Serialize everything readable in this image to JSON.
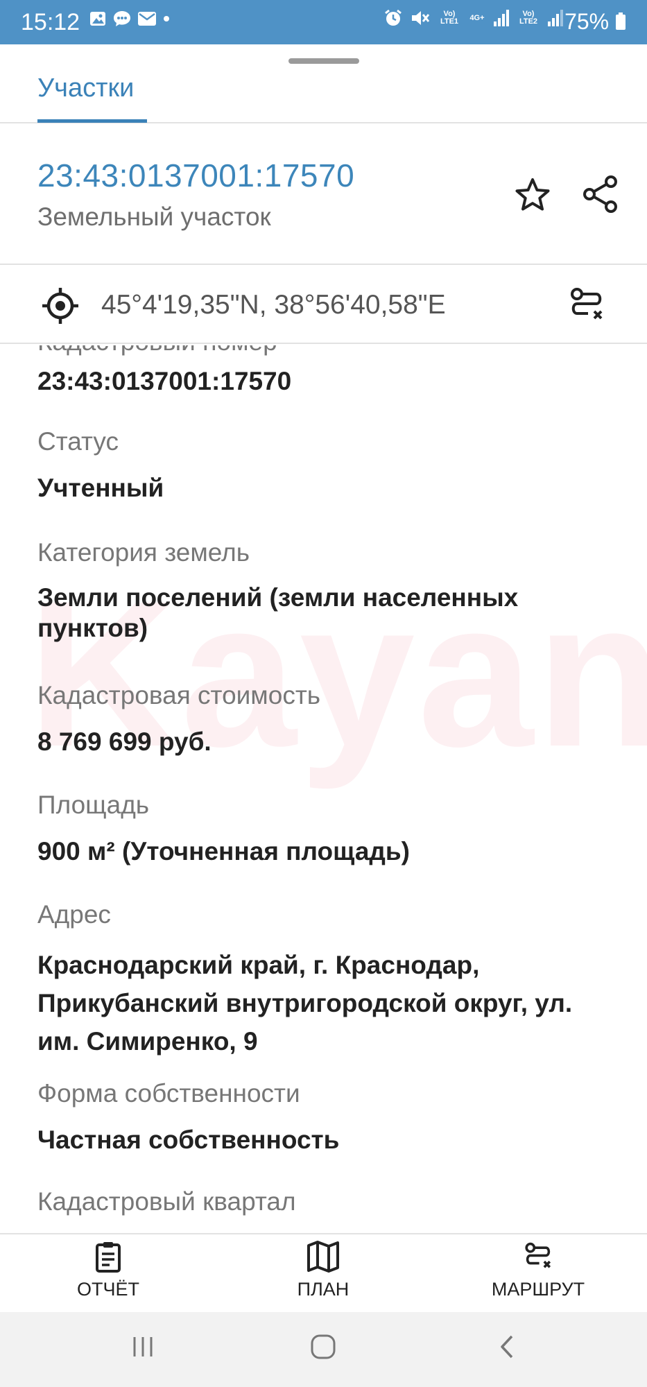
{
  "status_bar": {
    "time": "15:12",
    "battery": "75%",
    "network_labels": [
      "Vo) LTE1",
      "4G+",
      "Vo) LTE2"
    ]
  },
  "tabs": [
    {
      "label": "Участки",
      "active": true
    }
  ],
  "parcel": {
    "number": "23:43:0137001:17570",
    "type": "Земельный участок"
  },
  "coordinates": "45°4'19,35\"N, 38°56'40,58\"E",
  "watermark": "Kayan",
  "fields": {
    "cut_label": "Кадастровый номер",
    "cadastral_number_value": "23:43:0137001:17570",
    "status_label": "Статус",
    "status_value": "Учтенный",
    "category_label": "Категория земель",
    "category_value": "Земли поселений (земли населенных пунктов)",
    "cost_label": "Кадастровая стоимость",
    "cost_value": "8 769 699 руб.",
    "area_label": "Площадь",
    "area_value": "900 м² (Уточненная площадь)",
    "address_label": "Адрес",
    "address_value": "Краснодарский край, г. Краснодар, Прикубанский внутригородской округ, ул. им. Симиренко, 9",
    "ownership_label": "Форма собственности",
    "ownership_value": "Частная собственность",
    "quarter_label": "Кадастровый квартал"
  },
  "bottom_nav": {
    "report": "ОТЧЁТ",
    "plan": "ПЛАН",
    "route": "МАРШРУТ"
  },
  "colors": {
    "status_bar": "#4f92c6",
    "accent": "#3b82b8",
    "label_gray": "#777777"
  }
}
